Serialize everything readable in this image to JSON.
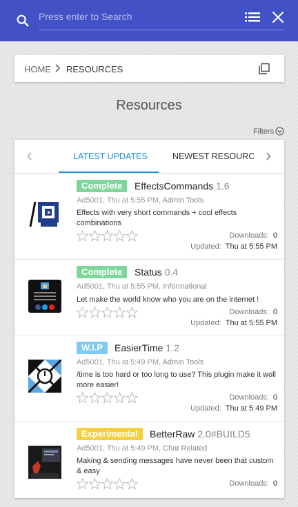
{
  "search": {
    "placeholder": "Press enter to Search"
  },
  "breadcrumb": {
    "home": "HOME",
    "current": "RESOURCES"
  },
  "page": {
    "title": "Resources",
    "filters_label": "Filters"
  },
  "tabs": {
    "active": "LATEST UPDATES",
    "next": "NEWEST RESOURCES"
  },
  "colors": {
    "topbar": "#4351c6",
    "accent": "#1e8fd8",
    "complete": "#7ed69b",
    "wip": "#7ecaf0",
    "experimental": "#f4d03f"
  },
  "resources": [
    {
      "badge": "Complete",
      "badge_type": "complete",
      "name": "EffectsCommands",
      "version": "1.6",
      "author": "Ad5001",
      "time": "Thu at 5:55 PM",
      "category": "Admin Tools",
      "description": "Effects with very short commands + cool effects combinations",
      "downloads_label": "Downloads:",
      "downloads": "0",
      "updated_label": "Updated:",
      "updated": "Thu at 5:55 PM",
      "rating": 0
    },
    {
      "badge": "Complete",
      "badge_type": "complete",
      "name": "Status",
      "version": "0.4",
      "author": "Ad5001",
      "time": "Thu at 5:55 PM",
      "category": "Informational",
      "description": "Let make the world know who you are on the internet !",
      "downloads_label": "Downloads:",
      "downloads": "0",
      "updated_label": "Updated:",
      "updated": "Thu at 5:55 PM",
      "rating": 0
    },
    {
      "badge": "W.I.P",
      "badge_type": "wip",
      "name": "EasierTime",
      "version": "1.2",
      "author": "Ad5001",
      "time": "Thu at 5:49 PM",
      "category": "Admin Tools",
      "description": "/time is too hard or too long to use? This plugin make it woll more easier!",
      "downloads_label": "Downloads:",
      "downloads": "0",
      "updated_label": "Updated:",
      "updated": "Thu at 5:49 PM",
      "rating": 0
    },
    {
      "badge": "Experimental",
      "badge_type": "experimental",
      "name": "BetterRaw",
      "version": "2.0#BUILD5",
      "author": "Ad5001",
      "time": "Thu at 5:49 PM",
      "category": "Chat Related",
      "description": "Making & sending messages have never been that custom & easy",
      "downloads_label": "Downloads:",
      "downloads": "0",
      "rating": 0
    }
  ]
}
